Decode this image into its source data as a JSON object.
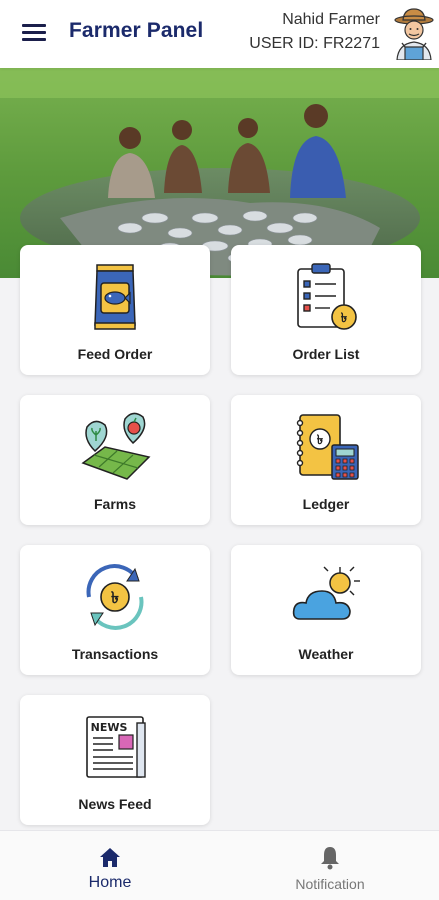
{
  "header": {
    "title": "Farmer Panel",
    "user_name": "Nahid Farmer",
    "user_id": "USER ID: FR2271",
    "menu_icon": "hamburger-menu-icon",
    "avatar_icon": "farmer-avatar-icon"
  },
  "hero": {
    "image": "fishermen-harvest-photo"
  },
  "menu": [
    {
      "label": "Feed Order",
      "icon": "feed-bag-icon"
    },
    {
      "label": "Order List",
      "icon": "clipboard-taka-icon"
    },
    {
      "label": "Farms",
      "icon": "farm-map-pins-icon"
    },
    {
      "label": "Ledger",
      "icon": "ledger-calculator-icon"
    },
    {
      "label": "Transactions",
      "icon": "taka-exchange-icon"
    },
    {
      "label": "Weather",
      "icon": "cloud-sun-icon"
    },
    {
      "label": "News Feed",
      "icon": "newspaper-icon"
    }
  ],
  "bottom_nav": {
    "home_label": "Home",
    "notification_label": "Notification",
    "home_icon": "home-icon",
    "notification_icon": "bell-icon"
  },
  "colors": {
    "brand": "#1b2a6b",
    "background": "#f3f3f5",
    "card": "#ffffff"
  }
}
